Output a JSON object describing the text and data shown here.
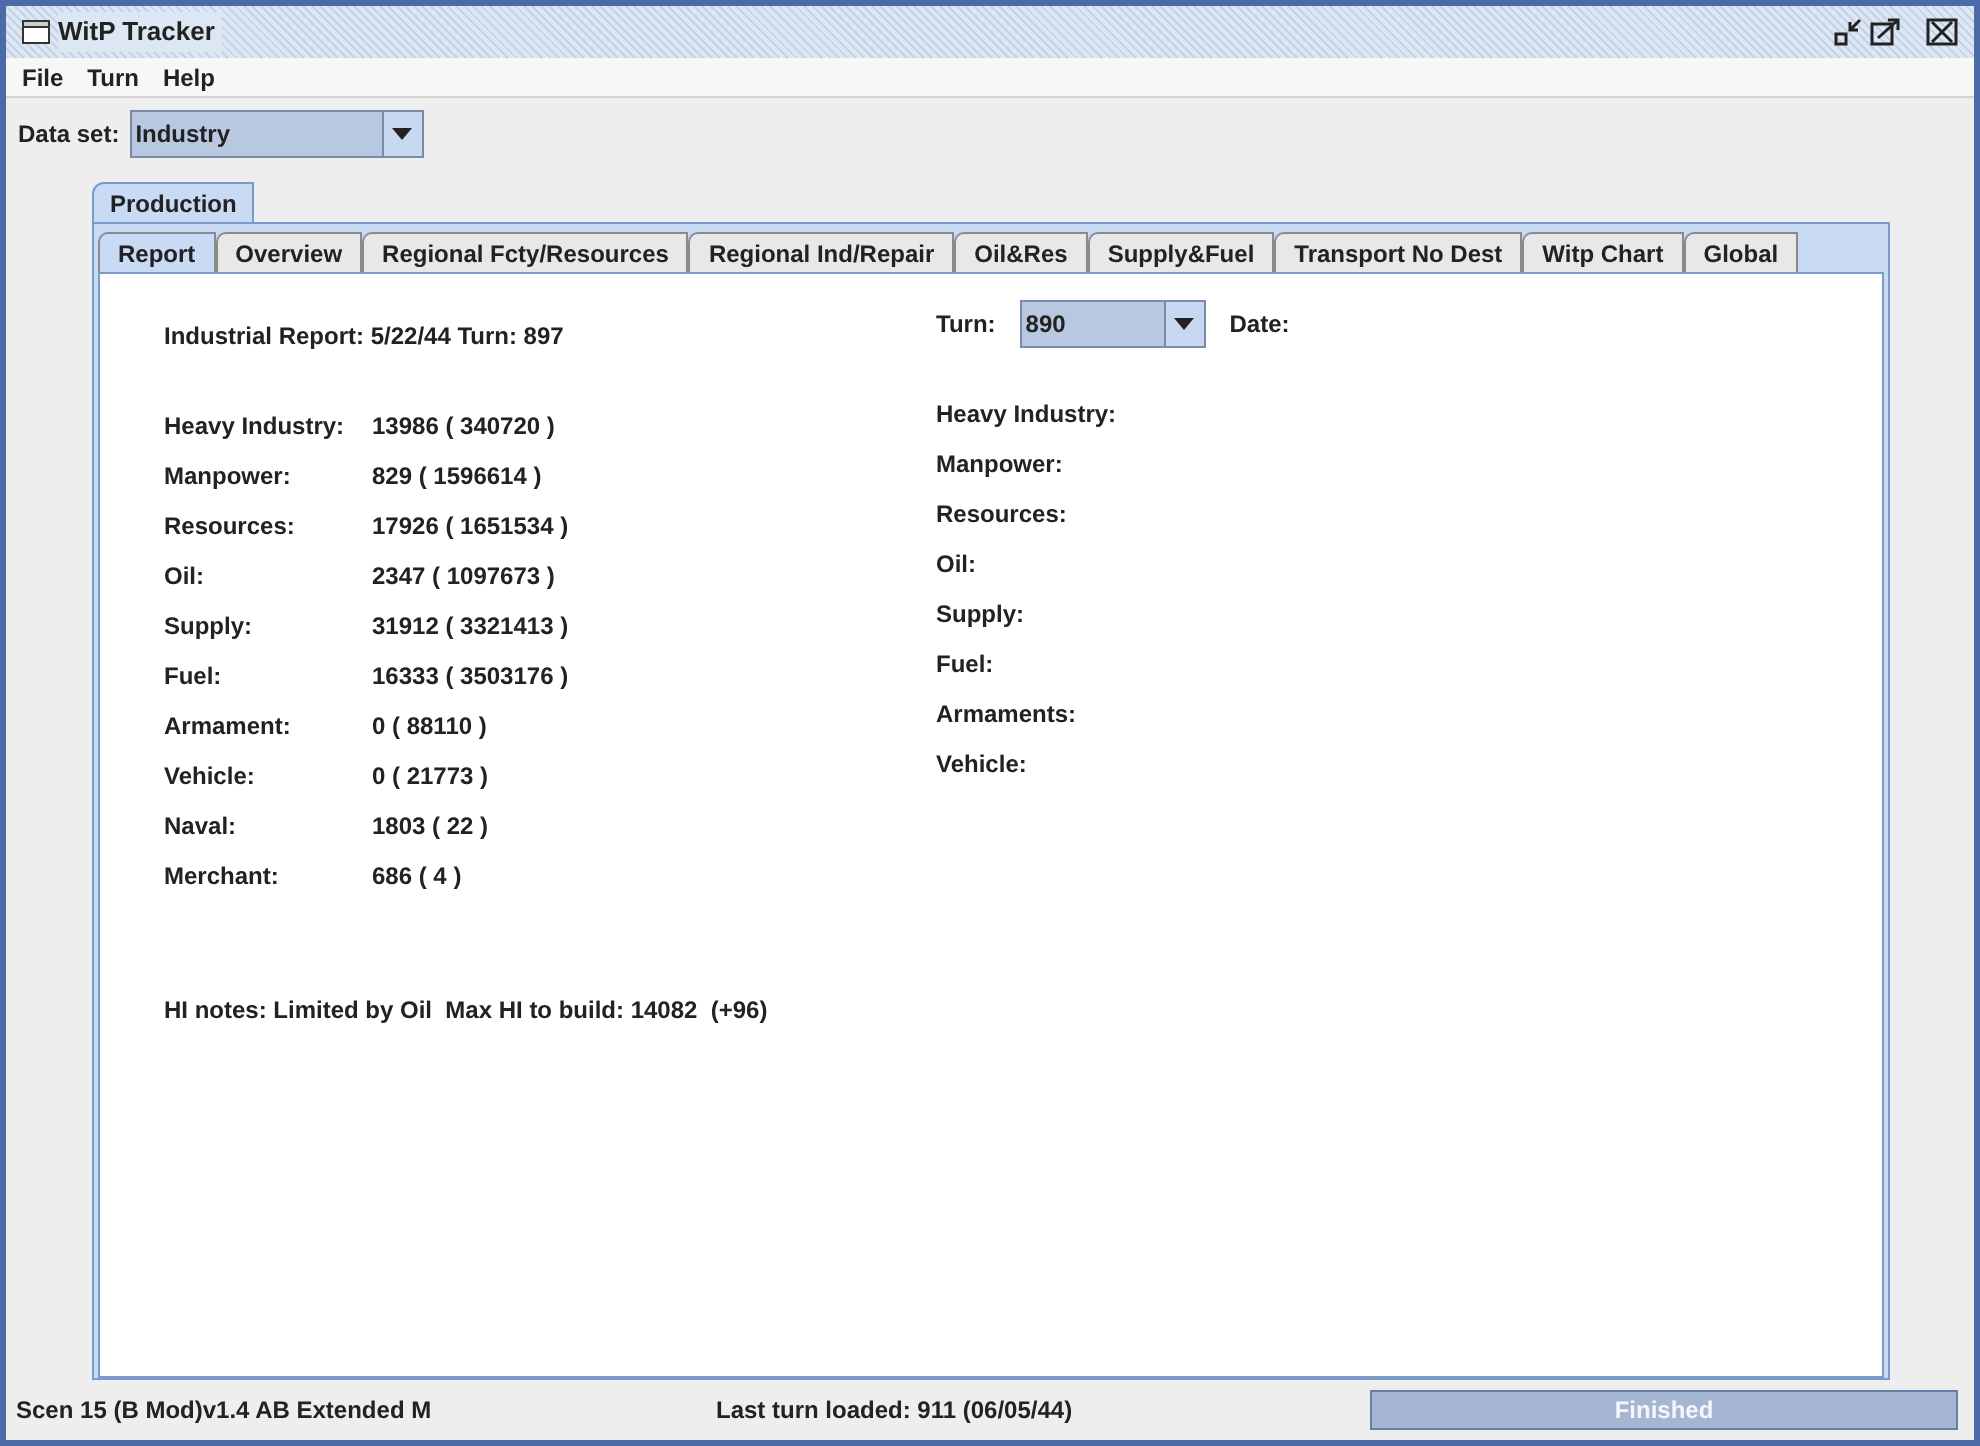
{
  "window": {
    "title": "WitP Tracker"
  },
  "menu": [
    "File",
    "Turn",
    "Help"
  ],
  "dataset": {
    "label": "Data set:",
    "value": "Industry"
  },
  "outer_tabs": [
    {
      "label": "Production",
      "selected": true
    }
  ],
  "tabs": [
    {
      "label": "Report",
      "selected": true
    },
    {
      "label": "Overview",
      "selected": false
    },
    {
      "label": "Regional Fcty/Resources",
      "selected": false
    },
    {
      "label": "Regional Ind/Repair",
      "selected": false
    },
    {
      "label": "Oil&Res",
      "selected": false
    },
    {
      "label": "Supply&Fuel",
      "selected": false
    },
    {
      "label": "Transport No Dest",
      "selected": false
    },
    {
      "label": "Witp Chart",
      "selected": false
    },
    {
      "label": "Global",
      "selected": false
    }
  ],
  "report": {
    "heading": "Industrial Report: 5/22/44  Turn: 897",
    "rows": [
      {
        "label": "Heavy Industry:",
        "value": "13986 ( 340720 )"
      },
      {
        "label": "Manpower:",
        "value": "829 ( 1596614 )"
      },
      {
        "label": "Resources:",
        "value": "17926 ( 1651534 )"
      },
      {
        "label": "Oil:",
        "value": "2347 ( 1097673 )"
      },
      {
        "label": "Supply:",
        "value": "31912 ( 3321413 )"
      },
      {
        "label": "Fuel:",
        "value": "16333 ( 3503176 )"
      },
      {
        "label": "Armament:",
        "value": "0 ( 88110 )"
      },
      {
        "label": "Vehicle:",
        "value": "0 ( 21773 )"
      },
      {
        "label": "Naval:",
        "value": "1803 ( 22 )"
      },
      {
        "label": "Merchant:",
        "value": "686 ( 4 )"
      }
    ],
    "notes": "HI notes: Limited by Oil  Max HI to build: 14082  (+96)"
  },
  "compare": {
    "turn_label": "Turn:",
    "turn_value": "890",
    "date_label": "Date:",
    "rows": [
      "Heavy Industry:",
      "Manpower:",
      "Resources:",
      "Oil:",
      "Supply:",
      "Fuel:",
      "Armaments:",
      "Vehicle:"
    ]
  },
  "status_bar": {
    "scenario": "Scen 15 (B Mod)v1.4 AB Extended M",
    "last_turn": "Last turn loaded: 911 (06/05/44)",
    "progress": {
      "label": "Finished",
      "level": 1
    }
  }
}
